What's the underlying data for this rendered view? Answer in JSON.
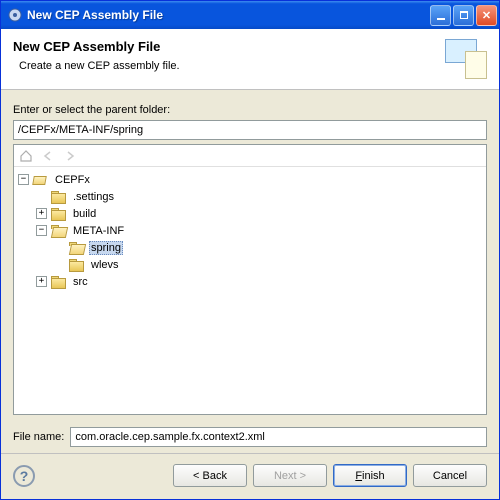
{
  "titlebar": {
    "title": "New CEP Assembly File"
  },
  "header": {
    "title": "New CEP Assembly File",
    "subtitle": "Create a new CEP assembly file."
  },
  "prompt": "Enter or select the parent folder:",
  "path_value": "/CEPFx/META-INF/spring",
  "tree": {
    "project": {
      "label": "CEPFx",
      "expanded": true,
      "children": [
        {
          "label": ".settings",
          "expanded": null,
          "selected": false
        },
        {
          "label": "build",
          "expanded": false,
          "selected": false
        },
        {
          "label": "META-INF",
          "expanded": true,
          "selected": false,
          "children": [
            {
              "label": "spring",
              "expanded": null,
              "selected": true
            },
            {
              "label": "wlevs",
              "expanded": null,
              "selected": false
            }
          ]
        },
        {
          "label": "src",
          "expanded": false,
          "selected": false
        }
      ]
    }
  },
  "filename": {
    "label": "File name:",
    "value": "com.oracle.cep.sample.fx.context2.xml"
  },
  "buttons": {
    "back": "< Back",
    "next": "Next >",
    "finish": "Finish",
    "cancel": "Cancel"
  },
  "help_tooltip": "?"
}
